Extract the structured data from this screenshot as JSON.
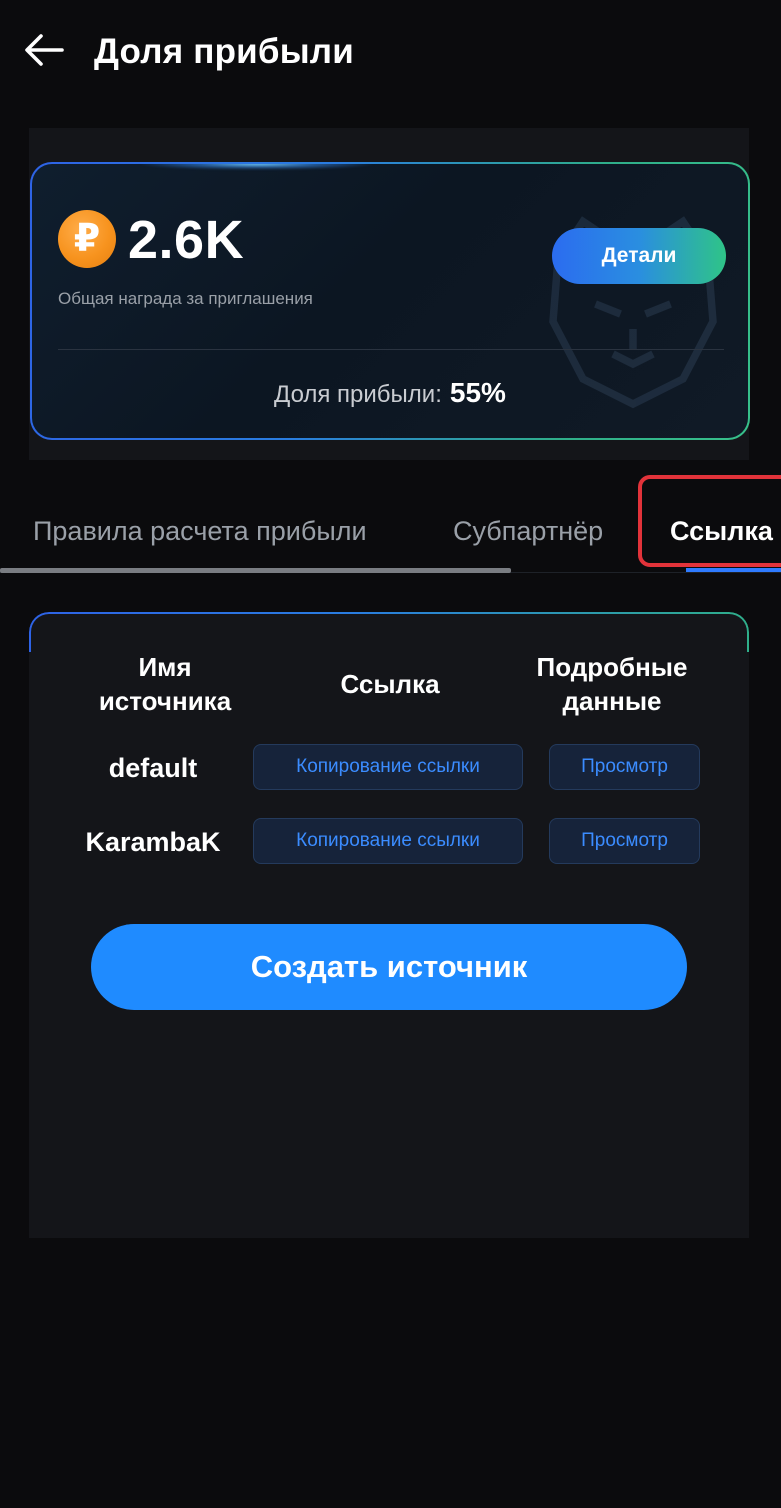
{
  "header": {
    "title": "Доля прибыли",
    "back_icon": "arrow-left-icon"
  },
  "summary": {
    "currency_icon": "ruble-coin-icon",
    "currency_symbol": "₽",
    "amount": "2.6K",
    "amount_label": "Общая награда за приглашения",
    "details_label": "Детали",
    "share_label": "Доля прибыли:",
    "share_value": "55%"
  },
  "tabs": [
    {
      "label": "Правила расчета прибыли",
      "active": false
    },
    {
      "label": "Субпартнёр",
      "active": false
    },
    {
      "label": "Ссылка",
      "active": true
    }
  ],
  "source_table": {
    "headers": {
      "name": "Имя источника",
      "link": "Ссылка",
      "details": "Подробные данные"
    },
    "rows": [
      {
        "name": "default",
        "copy_label": "Копирование ссылки",
        "view_label": "Просмотр"
      },
      {
        "name": "KarambaK",
        "copy_label": "Копирование ссылки",
        "view_label": "Просмотр"
      }
    ]
  },
  "create_button_label": "Создать источник",
  "colors": {
    "background": "#0b0b0d",
    "panel": "#141519",
    "accent_blue": "#1f8bff",
    "link_blue": "#3b8cff",
    "coin_orange": "#f7931e",
    "highlight_red": "#e2333a"
  }
}
